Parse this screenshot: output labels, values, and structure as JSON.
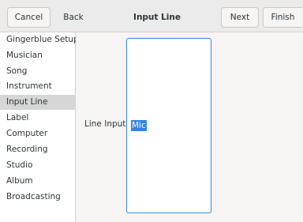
{
  "header": {
    "title": "Input Line",
    "cancel_label": "Cancel",
    "back_label": "Back",
    "next_label": "Next",
    "finish_label": "Finish"
  },
  "sidebar": {
    "items": [
      {
        "label": "Gingerblue Setup"
      },
      {
        "label": "Musician"
      },
      {
        "label": "Song"
      },
      {
        "label": "Instrument"
      },
      {
        "label": "Input Line",
        "selected": true
      },
      {
        "label": "Label"
      },
      {
        "label": "Computer"
      },
      {
        "label": "Recording"
      },
      {
        "label": "Studio"
      },
      {
        "label": "Album"
      },
      {
        "label": "Broadcasting"
      }
    ]
  },
  "main": {
    "line_input_label": "Line Input:",
    "line_input_value": "Mic"
  },
  "colors": {
    "accent": "#3584e4",
    "selected_row": "#d6d6d6",
    "headerbar": "#ebebeb"
  }
}
